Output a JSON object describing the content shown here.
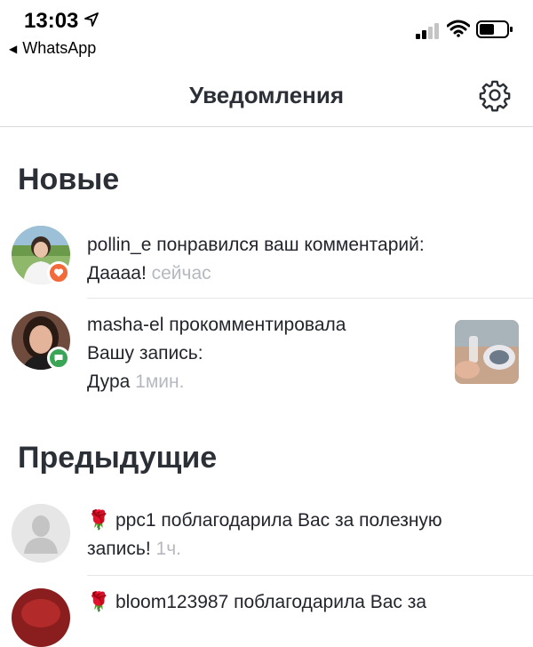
{
  "status_bar": {
    "time": "13:03",
    "back_app": "WhatsApp"
  },
  "header": {
    "title": "Уведомления",
    "settings_icon": "gear-icon"
  },
  "sections": {
    "new_title": "Новые",
    "previous_title": "Предыдущие"
  },
  "new_items": [
    {
      "user": "pollin_e",
      "action": "понравился ваш комментарий:",
      "content": "Даааа!",
      "time": "сейчас",
      "badge_icon": "heart-icon",
      "badge_color": "#f26a3a"
    },
    {
      "user": "masha-el",
      "action": "прокомментировала",
      "action2": "Вашу запись:",
      "content": "Дура",
      "time": "1мин.",
      "badge_icon": "comment-icon",
      "badge_color": "#3aa655"
    }
  ],
  "previous_items": [
    {
      "emoji": "🌹",
      "user": "ppc1",
      "action": "поблагодарила Вас за полезную",
      "action2": "запись!",
      "time": "1ч."
    },
    {
      "emoji": "🌹",
      "user": "bloom123987",
      "action": "поблагодарила Вас за"
    }
  ]
}
